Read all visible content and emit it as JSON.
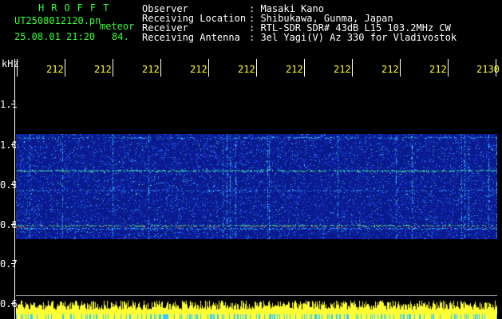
{
  "header": {
    "logo": "HROFFT",
    "filename": "UT2508012120.pn",
    "mode_label": "meteor",
    "datetime": "25.08.01 21:20",
    "mode_value": "84.",
    "fields": [
      {
        "label": "Observer",
        "value": ": Masaki Kano"
      },
      {
        "label": "Receiving Location",
        "value": ": Shibukawa, Gunma, Japan"
      },
      {
        "label": "Receiver",
        "value": ": RTL-SDR SDR# 43dB L15 103.2MHz CW"
      },
      {
        "label": "Receiving Antenna",
        "value": ": 3el Yagi(V) Az 330 for Vladivostok"
      }
    ]
  },
  "axes": {
    "y_unit": "kHz",
    "y_ticks": [
      "1.1",
      "1.0",
      "0.9",
      "0.8",
      "0.7",
      "0.6"
    ],
    "x_ticks": [
      "212",
      "212",
      "212",
      "212",
      "212",
      "212",
      "212",
      "212",
      "212",
      "2130"
    ]
  },
  "colors": {
    "text_green": "#33ff33",
    "text_white": "#ffffff",
    "background": "#000000",
    "spectrogram_base": "#0a1a8c",
    "signal_cyan": "#33ffff",
    "activity_yellow": "#ffff33"
  }
}
